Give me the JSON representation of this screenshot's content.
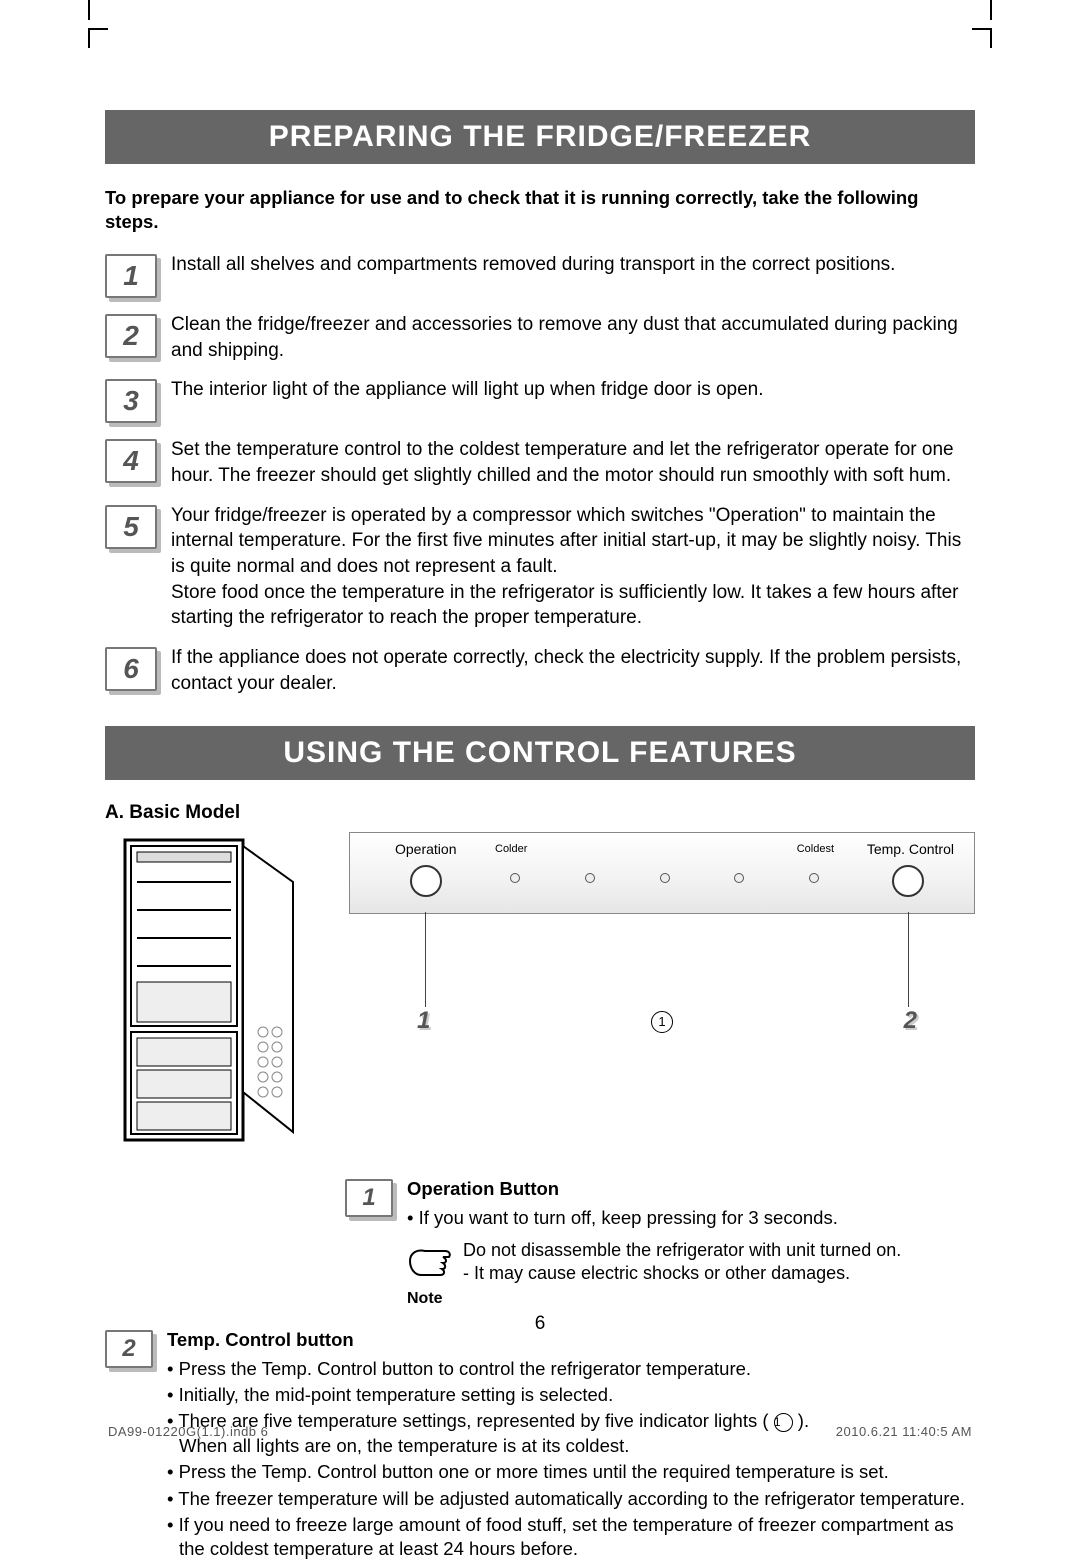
{
  "banners": {
    "prepare": "PREPARING THE FRIDGE/FREEZER",
    "controls": "USING THE CONTROL FEATURES"
  },
  "intro": "To prepare your appliance for use and to check that it is running correctly, take the following steps.",
  "steps": [
    {
      "n": "1",
      "text": "Install all shelves and compartments removed during transport in the correct positions."
    },
    {
      "n": "2",
      "text": "Clean the fridge/freezer and accessories to remove any dust that accumulated during packing and shipping."
    },
    {
      "n": "3",
      "text": "The interior light of the appliance will light up when fridge door is open."
    },
    {
      "n": "4",
      "text": "Set the temperature control to the coldest temperature and let the refrigerator operate for one hour. The freezer should get slightly chilled and the motor should run smoothly with soft hum."
    },
    {
      "n": "5",
      "text": "Your fridge/freezer is operated by a compressor which switches \"Operation\" to maintain the internal temperature. For the first five minutes after initial start-up, it may be slightly noisy. This is quite normal and does not represent a fault.\nStore food once the temperature in the refrigerator is sufficiently low. It takes a few hours after starting the refrigerator to reach the proper temperature."
    },
    {
      "n": "6",
      "text": "If the appliance does not operate correctly, check the electricity supply. If the problem persists, contact your dealer."
    }
  ],
  "controls": {
    "heading": "A. Basic Model",
    "panel": {
      "op": "Operation",
      "tc": "Temp. Control",
      "colder": "Colder",
      "coldest": "Coldest"
    },
    "callout1": "1",
    "callout2": "2",
    "calloutMid": "1",
    "op_button": {
      "n": "1",
      "title": "Operation Button",
      "bullets": [
        "If you want to turn off, keep pressing for 3 seconds."
      ],
      "note_label": "Note",
      "note_lines": [
        "Do not disassemble the refrigerator with unit turned on.",
        "- It may cause electric shocks or other damages."
      ]
    },
    "tc_button": {
      "n": "2",
      "title": "Temp. Control button",
      "bullets": [
        "Press the Temp. Control button to control the refrigerator temperature.",
        "Initially, the mid-point temperature setting is selected.",
        "There are five temperature settings, represented by five indicator lights ( <RING> ).\nWhen all lights are on, the temperature is at its coldest.",
        "Press the Temp. Control button one or more times until the required temperature is set.",
        "The freezer temperature will be adjusted automatically according to the refrigerator temperature.",
        "If you need to freeze large amount of food stuff, set the temperature of freezer compartment as the coldest temperature at least 24 hours before."
      ]
    }
  },
  "page_number": "6",
  "footer": {
    "left": "DA99-01220G(1.1).indb   6",
    "right": "2010.6.21   11:40:5 AM"
  }
}
